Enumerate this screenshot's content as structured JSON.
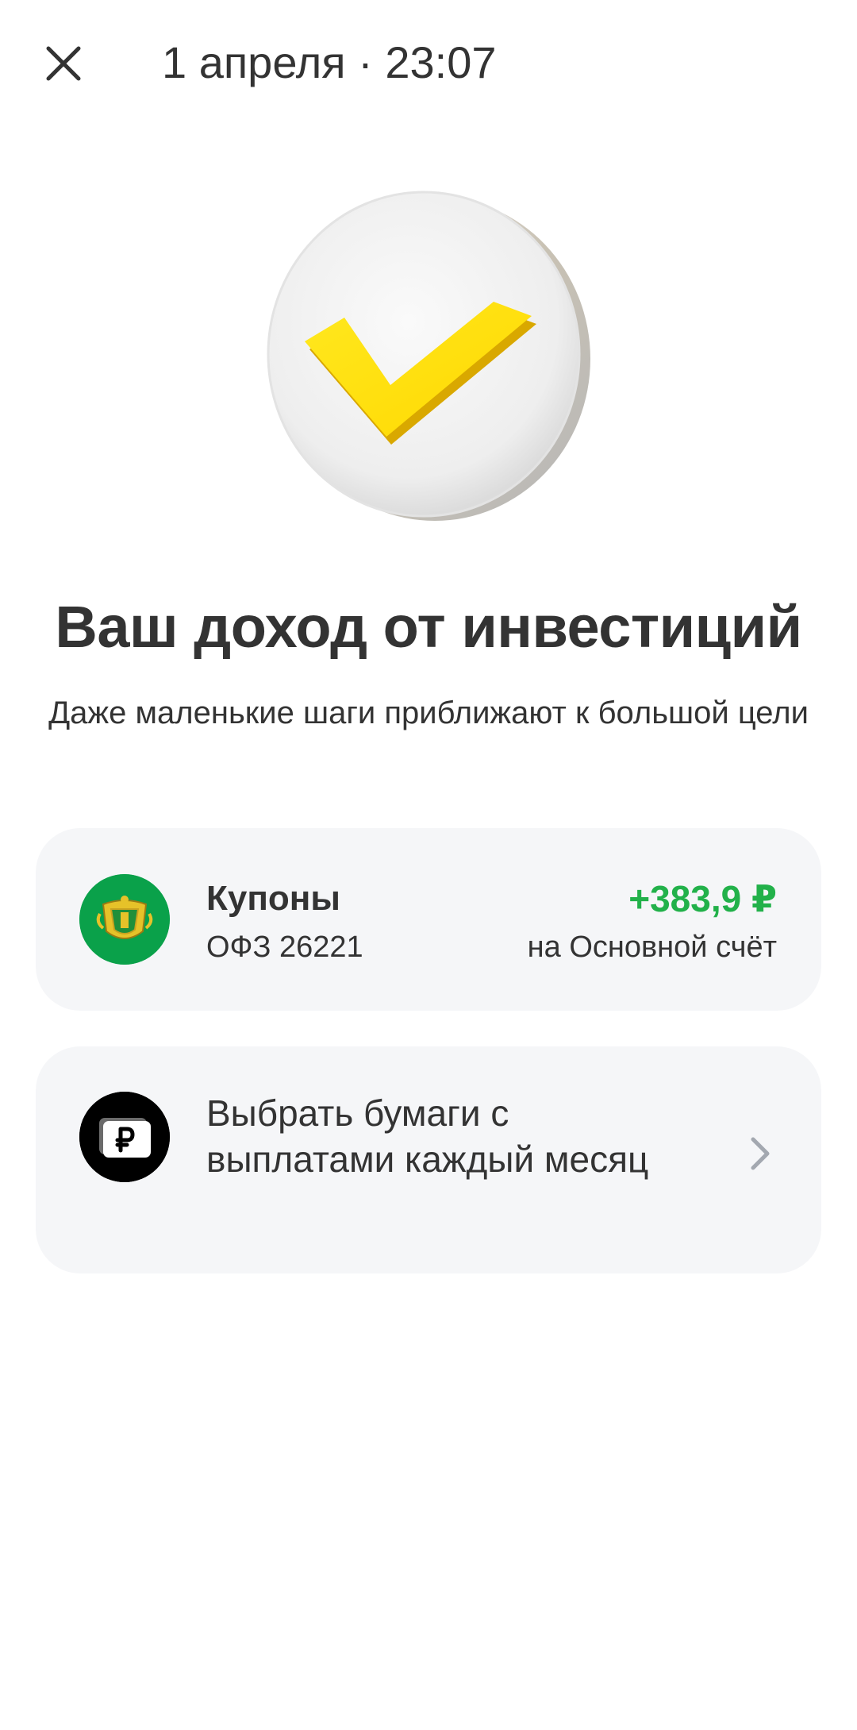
{
  "header": {
    "title": "1 апреля · 23:07",
    "close_icon": "close-icon"
  },
  "hero": {
    "icon": "checkmark-coin-icon",
    "accent_color": "#FFE11A"
  },
  "main": {
    "title": "Ваш доход от инвестиций",
    "subtitle": "Даже маленькие шаги приближают к большой цели"
  },
  "coupons_card": {
    "logo_icon": "ofz-emblem-icon",
    "name": "Купоны",
    "security": "ОФЗ 26221",
    "amount": "+383,9 ₽",
    "amount_color": "#22B14A",
    "destination": "на Основной счёт"
  },
  "select_card": {
    "logo_icon": "ruble-wallet-icon",
    "label": "Выбрать бумаги с выплатами каждый месяц",
    "chevron_icon": "chevron-right-icon"
  },
  "colors": {
    "card_background": "#F5F6F8",
    "text_primary": "#333333"
  }
}
